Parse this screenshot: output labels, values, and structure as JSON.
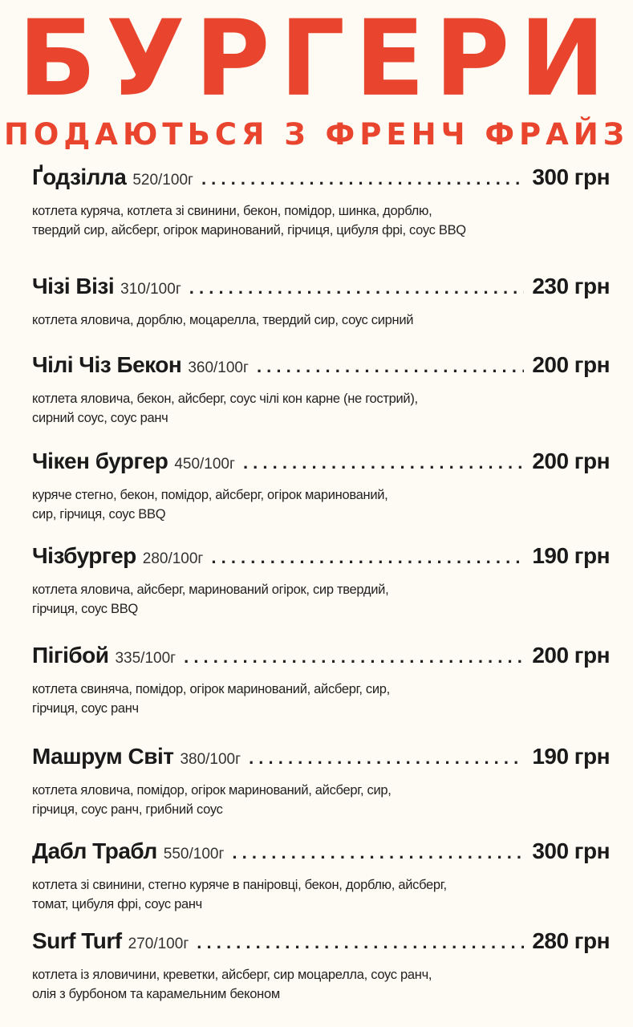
{
  "header": {
    "title": "БУРГЕРИ",
    "subtitle": "ПОДАЮТЬСЯ З ФРЕНЧ ФРАЙЗ"
  },
  "colors": {
    "accent": "#e8442e",
    "background": "#fdfbf3",
    "text": "#1a1a1a"
  },
  "items": [
    {
      "name": "Ґодзілла",
      "weight": "520/100г",
      "price": "300 грн",
      "description": "котлета куряча, котлета зі свинини, бекон, помідор, шинка, дорблю,\nтвердий сир, айсберг, огірок маринований, гірчиця, цибуля фрі, соус BBQ"
    },
    {
      "name": "Чізі Візі",
      "weight": "310/100г",
      "price": "230 грн",
      "description": "котлета яловича, дорблю, моцарелла, твердий сир, соус сирний"
    },
    {
      "name": "Чілі Чіз Бекон",
      "weight": "360/100г",
      "price": "200 грн",
      "description": "котлета яловича, бекон, айсберг, соус чілі кон карне (не гострий),\nсирний соус, соус ранч"
    },
    {
      "name": "Чікен бургер",
      "weight": "450/100г",
      "price": "200 грн",
      "description": "куряче стегно, бекон, помідор, айсберг, огірок маринований,\nсир, гірчиця, соус BBQ"
    },
    {
      "name": "Чізбургер",
      "weight": "280/100г",
      "price": "190 грн",
      "description": "котлета яловича, айсберг, маринований огірок, сир твердий,\nгірчиця, соус BBQ"
    },
    {
      "name": "Пігібой",
      "weight": "335/100г",
      "price": "200 грн",
      "description": "котлета свиняча, помідор, огірок маринований, айсберг, сир,\nгірчиця, соус ранч"
    },
    {
      "name": "Машрум Світ",
      "weight": "380/100г",
      "price": "190 грн",
      "description": "котлета яловича, помідор, огірок маринований, айсберг, сир,\nгірчиця, соус ранч, грибний соус"
    },
    {
      "name": "Дабл Трабл",
      "weight": "550/100г",
      "price": "300 грн",
      "description": "котлета зі свинини, стегно куряче в паніровці, бекон, дорблю, айсберг,\nтомат, цибуля фрі, соус ранч"
    },
    {
      "name": "Surf Turf",
      "weight": "270/100г",
      "price": "280 грн",
      "description": "котлета із яловичини, креветки, айсберг, сир моцарелла, соус ранч,\nолія з бурбоном та карамельним беконом"
    }
  ]
}
